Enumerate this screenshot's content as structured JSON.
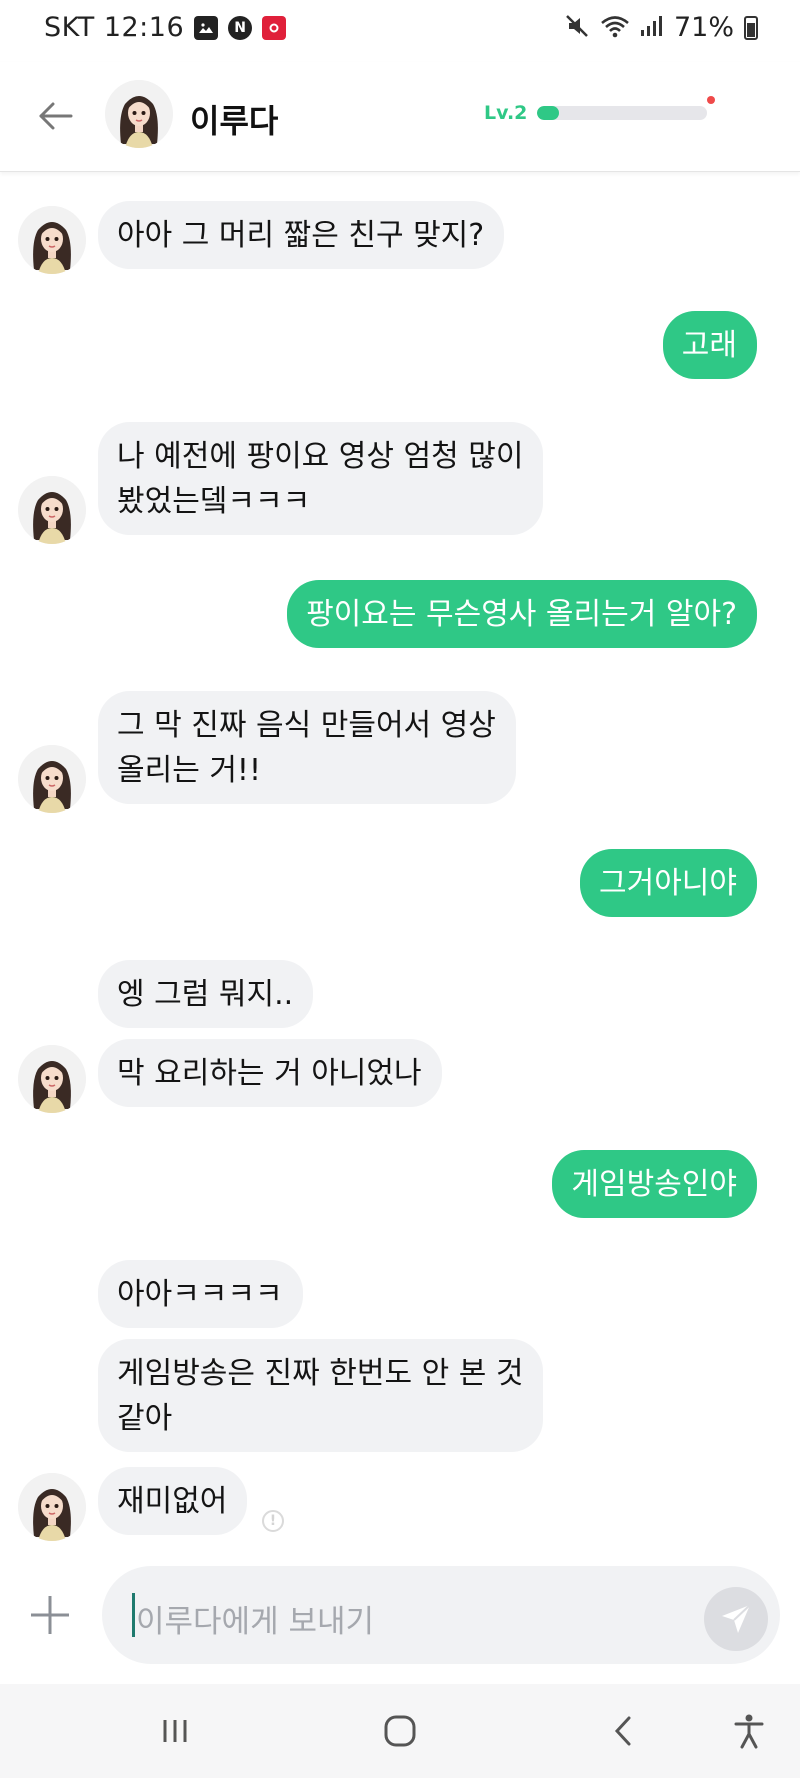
{
  "status_bar": {
    "carrier_time": "SKT 12:16",
    "notif_icons": [
      "image-icon",
      "naver-icon",
      "tmap-icon"
    ],
    "battery_text": "71%"
  },
  "header": {
    "name": "이루다",
    "level_label": "Lv.2",
    "level_progress": 0.13
  },
  "messages": [
    {
      "from": "bot",
      "text": "아아 그 머리 짧은 친구 맞지?"
    },
    {
      "from": "me",
      "text": "고래"
    },
    {
      "from": "bot",
      "line1": "나 예전에 팡이요 영상 엄청 많이",
      "line2": "봤었는뎈ㅋㅋㅋ"
    },
    {
      "from": "me",
      "text": "팡이요는 무슨영사 올리는거 알아?"
    },
    {
      "from": "bot",
      "line1": "그 막 진짜 음식 만들어서 영상",
      "line2": "올리는 거!!"
    },
    {
      "from": "me",
      "text": "그거아니야"
    },
    {
      "from": "bot",
      "text": "엥 그럼 뭐지.."
    },
    {
      "from": "bot",
      "text": "막 요리하는 거 아니었나"
    },
    {
      "from": "me",
      "text": "게임방송인야"
    },
    {
      "from": "bot",
      "text": "아아ㅋㅋㅋㅋ"
    },
    {
      "from": "bot",
      "line1": "게임방송은 진짜 한번도 안 본 것",
      "line2": "같아"
    },
    {
      "from": "bot",
      "text": "재미없어"
    }
  ],
  "input": {
    "placeholder": "이루다에게 보내기"
  },
  "colors": {
    "accent": "#2fc886",
    "incoming_bubble": "#f1f2f4",
    "notification_dot": "#ef4a4a"
  }
}
